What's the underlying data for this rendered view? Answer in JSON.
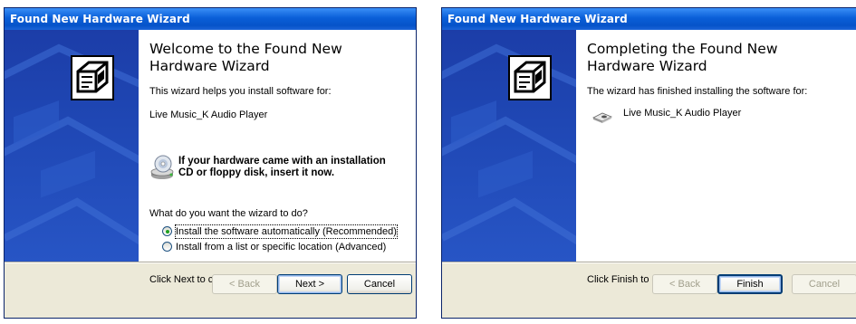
{
  "windows": [
    {
      "title": "Found New Hardware Wizard",
      "heading": "Welcome to the Found New Hardware Wizard",
      "intro": "This wizard helps you install software for:",
      "device": "Live Music_K Audio Player",
      "cd_prompt": "If your hardware came with an installation CD or floppy disk, insert it now.",
      "question": "What do you want the wizard to do?",
      "options": [
        {
          "label": "Install the software automatically (Recommended)",
          "selected": true
        },
        {
          "label": "Install from a list or specific location (Advanced)",
          "selected": false
        }
      ],
      "footer": "Click Next to continue.",
      "buttons": {
        "back": "< Back",
        "next": "Next >",
        "cancel": "Cancel"
      }
    },
    {
      "title": "Found New Hardware Wizard",
      "heading": "Completing the Found New Hardware Wizard",
      "intro": "The wizard has finished installing the software for:",
      "device": "Live Music_K Audio Player",
      "footer": "Click Finish to close the wizard.",
      "buttons": {
        "back": "< Back",
        "finish": "Finish",
        "cancel": "Cancel"
      }
    }
  ],
  "colors": {
    "titlebar": "#0a5fd8",
    "sidebar": "#1f47b4",
    "chrome": "#ece9d8",
    "radio_dot": "#21a121"
  },
  "icons": [
    "hardware-wizard-icon",
    "cd-drive-icon",
    "audio-device-icon"
  ]
}
